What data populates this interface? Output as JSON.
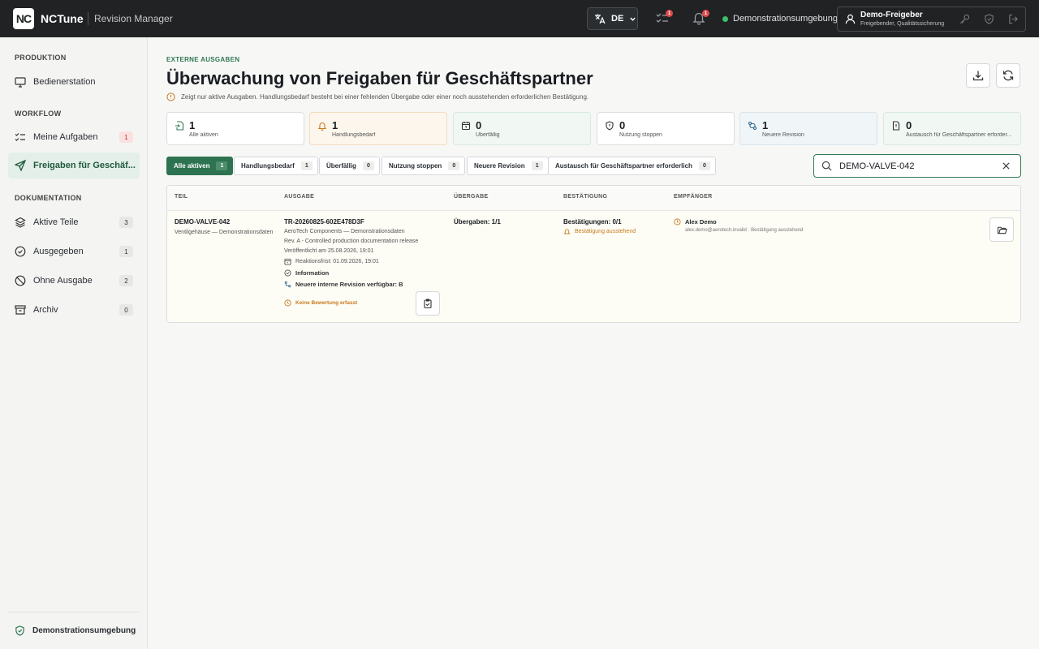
{
  "header": {
    "logo_text": "NC",
    "brand": "NCTune",
    "product": "Revision Manager",
    "language": "DE",
    "tasks_badge": "1",
    "notifications_badge": "1",
    "environment": "Demonstrationsumgebung",
    "user_name": "Demo-Freigeber",
    "user_role": "Freigebender, Qualitätssicherung",
    "env_status_color": "#3fbf6a"
  },
  "sidebar": {
    "sections": [
      {
        "label": "PRODUKTION"
      },
      {
        "label": "WORKFLOW"
      },
      {
        "label": "DOKUMENTATION"
      }
    ],
    "items": [
      {
        "label": "Bedienerstation",
        "icon": "monitor-icon"
      },
      {
        "label": "Meine Aufgaben",
        "count": "1",
        "icon": "tasks-icon"
      },
      {
        "label": "Freigaben für Geschäf...",
        "icon": "send-icon",
        "active": true
      },
      {
        "label": "Aktive Teile",
        "count": "3",
        "icon": "layers-icon"
      },
      {
        "label": "Ausgegeben",
        "count": "1",
        "icon": "check-circle-icon"
      },
      {
        "label": "Ohne Ausgabe",
        "count": "2",
        "icon": "no-issue-icon"
      },
      {
        "label": "Archiv",
        "count": "0",
        "icon": "archive-icon"
      }
    ],
    "footer": "Demonstrationsumgebung"
  },
  "page": {
    "eyebrow": "EXTERNE AUSGABEN",
    "title": "Überwachung von Freigaben für Geschäftspartner",
    "hint": "Zeigt nur aktive Ausgaben. Handlungsbedarf besteht bei einer fehlenden Übergabe oder einer noch ausstehenden erforderlichen Bestätigung."
  },
  "stats": [
    {
      "value": "1",
      "label": "Alle aktiven",
      "icon": "file-in-icon"
    },
    {
      "value": "1",
      "label": "Handlungsbedarf",
      "icon": "bell-icon"
    },
    {
      "value": "0",
      "label": "Überfällig",
      "icon": "alarm-clock-icon"
    },
    {
      "value": "0",
      "label": "Nutzung stoppen",
      "icon": "shield-alert-icon"
    },
    {
      "value": "1",
      "label": "Neuere Revision",
      "icon": "revision-icon"
    },
    {
      "value": "0",
      "label": "Austausch für Geschäftspartner erforder...",
      "icon": "file-alert-icon"
    }
  ],
  "filters": [
    {
      "label": "Alle aktiven",
      "count": "1",
      "active": true
    },
    {
      "label": "Handlungsbedarf",
      "count": "1"
    },
    {
      "label": "Überfällig",
      "count": "0"
    },
    {
      "label": "Nutzung stoppen",
      "count": "0"
    },
    {
      "label": "Neuere Revision",
      "count": "1"
    },
    {
      "label": "Austausch für Geschäftspartner erforderlich",
      "count": "0"
    }
  ],
  "search": {
    "value": "DEMO-VALVE-042"
  },
  "table": {
    "columns": [
      "TEIL",
      "AUSGABE",
      "ÜBERGABE",
      "BESTÄTIGUNG",
      "EMPFÄNGER"
    ],
    "rows": [
      {
        "part_id": "DEMO-VALVE-042",
        "part_desc": "Ventilgehäuse — Demonstrationsdaten",
        "issue_id": "TR-20260825-602E478D3F",
        "issue_company": "AeroTech Components — Demonstrationsdaten",
        "issue_rev": "Rev. A - Controlled production documentation release",
        "issue_published": "Veröffentlicht am 25.08.2026, 19:01",
        "issue_deadline": "Reaktionsfrist: 01.09.2026, 19:01",
        "issue_info": "Information",
        "issue_newer": "Neuere interne Revision verfügbar: B",
        "issue_rating": "Keine Bewertung erfasst",
        "handover": "Übergaben: 1/1",
        "confirmation": "Bestätigungen: 0/1",
        "confirmation_status": "Bestätigung ausstehend",
        "recipient_name": "Alex Demo",
        "recipient_detail": "alex.demo@aerotech.invalid · Bestätigung ausstehend"
      }
    ]
  },
  "colors": {
    "accent": "#2e7351",
    "warning": "#c87a1e",
    "badge_red": "#e04a4a",
    "topbar": "#202224"
  }
}
